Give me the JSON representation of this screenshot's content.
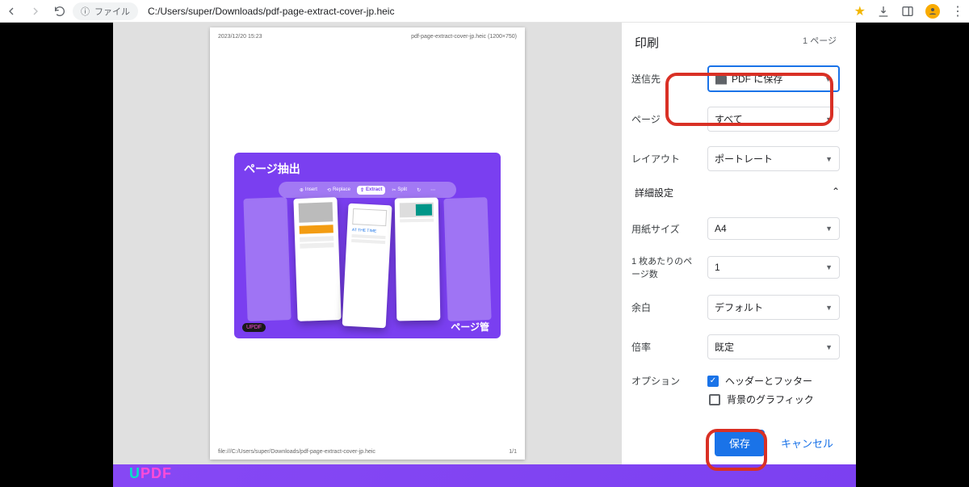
{
  "browser": {
    "file_label": "ファイル",
    "url": "C:/Users/super/Downloads/pdf-page-extract-cover-jp.heic"
  },
  "preview": {
    "header_left": "2023/12/20 15:23",
    "header_right": "pdf-page-extract-cover-jp.heic (1200×750)",
    "footer_left": "file:///C:/Users/super/Downloads/pdf-page-extract-cover-jp.heic",
    "footer_right": "1/1",
    "hero_title": "ページ抽出",
    "hero_sub": "ページ管",
    "tools": {
      "insert": "Insert",
      "replace": "Replace",
      "extract": "Extract",
      "split": "Split"
    },
    "brand": "UPDF"
  },
  "print": {
    "title": "印刷",
    "sheet_count": "1 ページ",
    "rows": {
      "destination_label": "送信先",
      "destination_value": "PDF に保存",
      "pages_label": "ページ",
      "pages_value": "すべて",
      "layout_label": "レイアウト",
      "layout_value": "ポートレート",
      "advanced_label": "詳細設定",
      "paper_label": "用紙サイズ",
      "paper_value": "A4",
      "per_sheet_label": "1 枚あたりのページ数",
      "per_sheet_value": "1",
      "margin_label": "余白",
      "margin_value": "デフォルト",
      "scale_label": "倍率",
      "scale_value": "既定",
      "options_label": "オプション",
      "opt_header_footer": "ヘッダーとフッター",
      "opt_background": "背景のグラフィック"
    },
    "save": "保存",
    "cancel": "キャンセル"
  },
  "footer_brand": {
    "u": "U",
    "pdf": "PDF"
  }
}
